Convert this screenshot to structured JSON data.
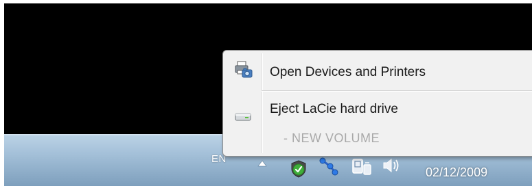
{
  "context_menu": {
    "items": [
      {
        "label": "Open Devices and Printers",
        "icon": "printer-camera-icon"
      },
      {
        "label": "Eject LaCie hard drive",
        "icon": "external-drive-icon"
      }
    ],
    "sub_item": "-  NEW VOLUME"
  },
  "taskbar": {
    "language": "EN",
    "clock": "02/12/2009",
    "tray_icons": [
      "show-hidden-icons-chevron-icon",
      "security-shield-check-icon",
      "network-icon",
      "safely-remove-hardware-icon",
      "volume-speaker-icon"
    ]
  },
  "colors": {
    "desktop": "#000000",
    "taskbar": "#a6c2da",
    "menu_background": "#f1f1f1",
    "menu_text": "#1a1a1a",
    "menu_disabled_text": "#a9a9a9"
  }
}
